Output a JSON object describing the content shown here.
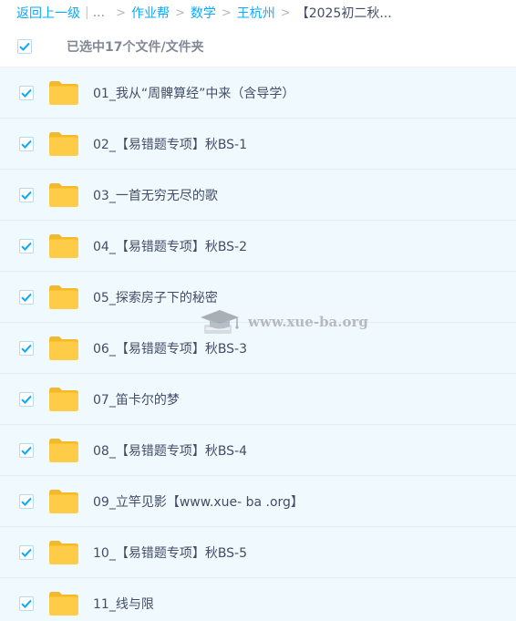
{
  "breadcrumb": {
    "back": "返回上一级",
    "pipe": "|",
    "dots": "...",
    "sep": ">",
    "crumbs": [
      "作业帮",
      "数学",
      "王杭州"
    ],
    "current": "【2025初二秋..."
  },
  "selection": {
    "text": "已选中17个文件/文件夹",
    "checked": true
  },
  "files": [
    {
      "name": "01_我从“周髀算经”中来（含导学）"
    },
    {
      "name": "02_【易错题专项】秋BS-1"
    },
    {
      "name": "03_一首无穷无尽的歌"
    },
    {
      "name": "04_【易错题专项】秋BS-2"
    },
    {
      "name": "05_探索房子下的秘密"
    },
    {
      "name": "06_【易错题专项】秋BS-3"
    },
    {
      "name": "07_笛卡尔的梦"
    },
    {
      "name": "08_【易错题专项】秋BS-4"
    },
    {
      "name": "09_立竿见影【www.xue- ba .org】"
    },
    {
      "name": "10_【易错题专项】秋BS-5"
    },
    {
      "name": "11_线与限"
    }
  ],
  "watermark": {
    "text": "www.xue-ba.org"
  },
  "icons": {
    "checkbox": "checkbox-checked-icon",
    "folder": "folder-icon",
    "watermark_logo": "graduation-cap-icon"
  },
  "colors": {
    "accent": "#09AAFF",
    "folder": "#FFC83D",
    "row_bg": "#f0f9fe",
    "text": "#424e67"
  }
}
